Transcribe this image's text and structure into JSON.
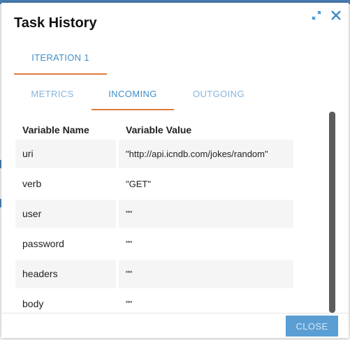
{
  "dialog": {
    "title": "Task History",
    "close_label": "CLOSE",
    "icons": {
      "expand": "expand-arrows-icon",
      "close": "close-x-icon"
    }
  },
  "tabs": {
    "iteration": "ITERATION 1",
    "sub": [
      {
        "label": "METRICS",
        "active": false
      },
      {
        "label": "INCOMING",
        "active": true
      },
      {
        "label": "OUTGOING",
        "active": false
      }
    ]
  },
  "table": {
    "headers": {
      "name": "Variable Name",
      "value": "Variable Value"
    },
    "rows": [
      {
        "name": "uri",
        "value": "\"http://api.icndb.com/jokes/random\""
      },
      {
        "name": "verb",
        "value": "\"GET\""
      },
      {
        "name": "user",
        "value": "\"\""
      },
      {
        "name": "password",
        "value": "\"\""
      },
      {
        "name": "headers",
        "value": "\"\""
      },
      {
        "name": "body",
        "value": "\"\""
      }
    ]
  },
  "colors": {
    "accent_blue": "#3f8ecb",
    "accent_orange": "#e07b39",
    "button_blue": "#5a9ed4"
  }
}
